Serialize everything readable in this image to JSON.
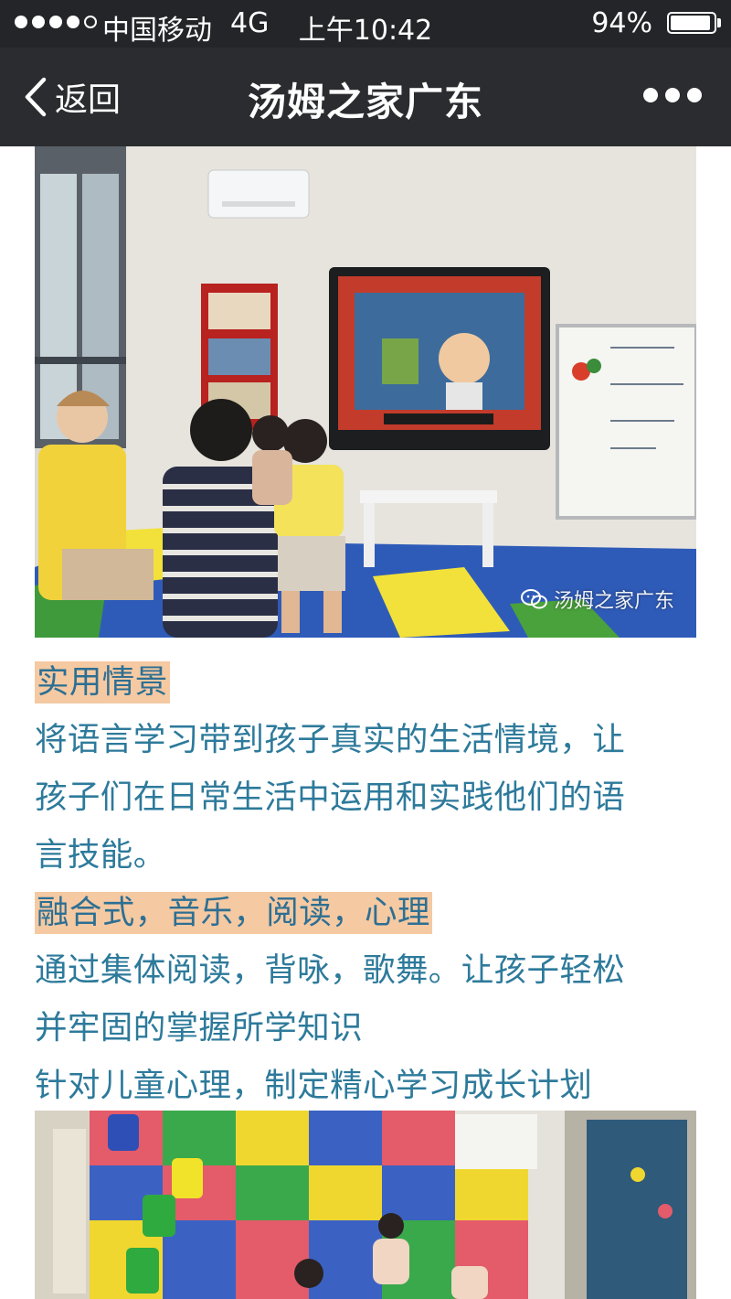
{
  "status_bar": {
    "carrier": "中国移动",
    "network": "4G",
    "time": "上午10:42",
    "battery_percent": "94%",
    "battery_level": 0.94,
    "signal_bars_filled": 4,
    "signal_bars_total": 5
  },
  "nav": {
    "back_label": "返回",
    "title": "汤姆之家广东",
    "more_icon": "more-dots-icon",
    "back_icon": "chevron-left-icon"
  },
  "article": {
    "watermark": "汤姆之家广东",
    "sections": [
      {
        "heading": "实用情景",
        "lines": [
          "将语言学习带到孩子真实的生活情境，让",
          "孩子们在日常生活中运用和实践他们的语",
          "言技能。"
        ]
      },
      {
        "heading": "融合式，音乐，阅读，心理",
        "lines": [
          "通过集体阅读，背咏，歌舞。让孩子轻松",
          "并牢固的掌握所学知识",
          "针对儿童心理，制定精心学习成长计划"
        ]
      }
    ]
  },
  "colors": {
    "text": "#2d7a9b",
    "heading_highlight": "#f5c9a2",
    "nav_background": "#2b2c2f",
    "status_background": "#242528"
  }
}
